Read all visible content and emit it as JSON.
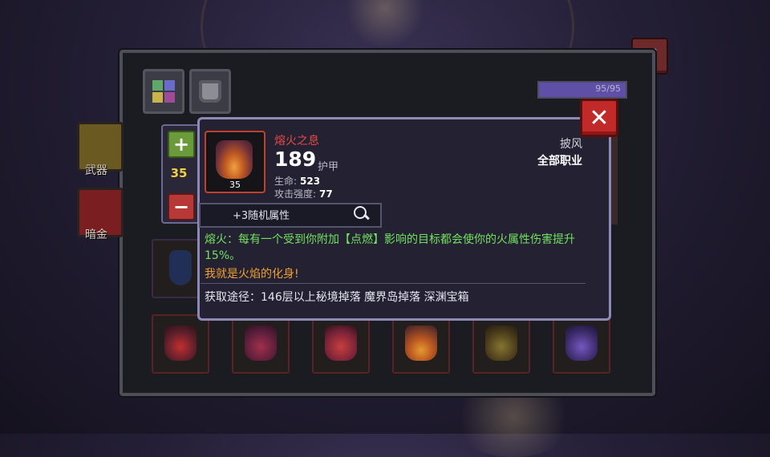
{
  "panel": {
    "hp_text": "95/95",
    "hp_fraction": 1.0,
    "tabs": [
      {
        "name": "inventory-tab",
        "icon": "grid-icon"
      },
      {
        "name": "equipment-tab",
        "icon": "armor-icon"
      }
    ],
    "side_buttons": [
      {
        "label": "武器"
      },
      {
        "label": "暗金"
      }
    ]
  },
  "tooltip": {
    "item_name": "熔火之息",
    "item_level": "35",
    "armor_value": "189",
    "armor_label": "护甲",
    "stats": [
      {
        "label": "生命:",
        "value": "523"
      },
      {
        "label": "攻击强度:",
        "value": "77"
      }
    ],
    "slot_type": "披风",
    "class_requirement": "全部职业",
    "level_control": "35",
    "random_attributes": "+3随机属性",
    "effect_text": "熔火：每有一个受到你附加【点燃】影响的目标都会使你的火属性伤害提升15%。",
    "flavor_text": "我就是火焰的化身!",
    "source_text": "获取途径：146层以上秘境掉落 魔界岛掉落 深渊宝箱"
  },
  "colors": {
    "item_name": "#e84848",
    "effect": "#72e060",
    "flavor": "#f0a030",
    "level": "#f0d040",
    "close": "#c22a2a"
  }
}
